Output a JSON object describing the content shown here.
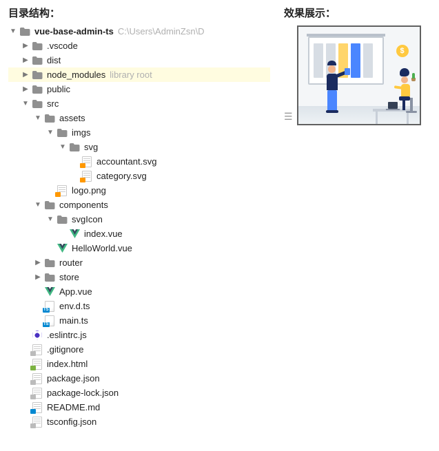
{
  "left_title": "目录结构：",
  "right_title": "效果展示：",
  "tree": [
    {
      "depth": 0,
      "arrow": "down",
      "icon": "folder",
      "label": "vue-base-admin-ts",
      "bold": true,
      "extra": "C:\\Users\\AdminZsn\\D",
      "interact": true
    },
    {
      "depth": 1,
      "arrow": "right",
      "icon": "folder",
      "label": ".vscode",
      "interact": true
    },
    {
      "depth": 1,
      "arrow": "right",
      "icon": "folder",
      "label": "dist",
      "interact": true
    },
    {
      "depth": 1,
      "arrow": "right",
      "icon": "folder",
      "label": "node_modules",
      "extra": "library root",
      "highlight": true,
      "interact": true
    },
    {
      "depth": 1,
      "arrow": "right",
      "icon": "folder",
      "label": "public",
      "interact": true
    },
    {
      "depth": 1,
      "arrow": "down",
      "icon": "folder",
      "label": "src",
      "interact": true
    },
    {
      "depth": 2,
      "arrow": "down",
      "icon": "folder",
      "label": "assets",
      "interact": true
    },
    {
      "depth": 3,
      "arrow": "down",
      "icon": "folder",
      "label": "imgs",
      "interact": true
    },
    {
      "depth": 4,
      "arrow": "down",
      "icon": "folder",
      "label": "svg",
      "interact": true
    },
    {
      "depth": 5,
      "arrow": "none",
      "icon": "file-orange",
      "label": "accountant.svg",
      "interact": true
    },
    {
      "depth": 5,
      "arrow": "none",
      "icon": "file-orange",
      "label": "category.svg",
      "interact": true
    },
    {
      "depth": 3,
      "arrow": "none",
      "icon": "file-orange",
      "label": "logo.png",
      "interact": true
    },
    {
      "depth": 2,
      "arrow": "down",
      "icon": "folder",
      "label": "components",
      "interact": true
    },
    {
      "depth": 3,
      "arrow": "down",
      "icon": "folder",
      "label": "svgIcon",
      "interact": true
    },
    {
      "depth": 4,
      "arrow": "none",
      "icon": "vue",
      "label": "index.vue",
      "interact": true
    },
    {
      "depth": 3,
      "arrow": "none",
      "icon": "vue",
      "label": "HelloWorld.vue",
      "interact": true
    },
    {
      "depth": 2,
      "arrow": "right",
      "icon": "folder",
      "label": "router",
      "interact": true
    },
    {
      "depth": 2,
      "arrow": "right",
      "icon": "folder",
      "label": "store",
      "interact": true
    },
    {
      "depth": 2,
      "arrow": "none",
      "icon": "vue",
      "label": "App.vue",
      "interact": true
    },
    {
      "depth": 2,
      "arrow": "none",
      "icon": "ts",
      "label": "env.d.ts",
      "interact": true
    },
    {
      "depth": 2,
      "arrow": "none",
      "icon": "ts",
      "label": "main.ts",
      "interact": true
    },
    {
      "depth": 1,
      "arrow": "none",
      "icon": "eslint",
      "label": ".eslintrc.js",
      "interact": true
    },
    {
      "depth": 1,
      "arrow": "none",
      "icon": "file-json",
      "label": ".gitignore",
      "interact": true
    },
    {
      "depth": 1,
      "arrow": "none",
      "icon": "file-html",
      "label": "index.html",
      "interact": true
    },
    {
      "depth": 1,
      "arrow": "none",
      "icon": "file-json",
      "label": "package.json",
      "interact": true
    },
    {
      "depth": 1,
      "arrow": "none",
      "icon": "file-json",
      "label": "package-lock.json",
      "interact": true
    },
    {
      "depth": 1,
      "arrow": "none",
      "icon": "file-md",
      "label": "README.md",
      "interact": true
    },
    {
      "depth": 1,
      "arrow": "none",
      "icon": "file-json",
      "label": "tsconfig.json",
      "interact": true
    }
  ]
}
